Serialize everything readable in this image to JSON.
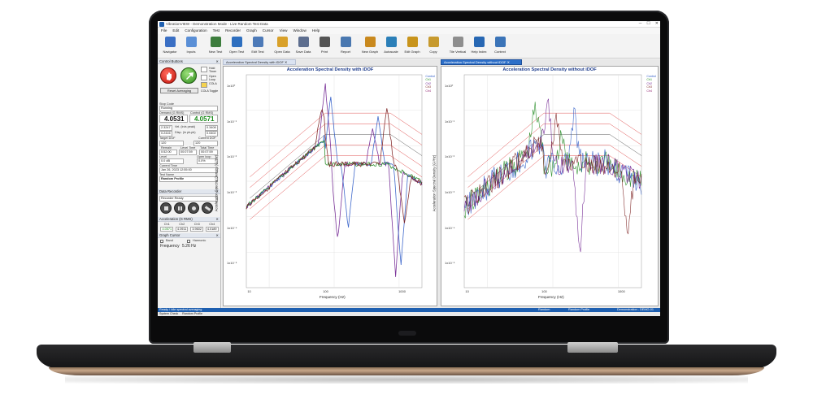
{
  "window": {
    "title": "VibrationVIEW - Demonstration Mode - Live Random Test Data",
    "controls": [
      "─",
      "☐",
      "✕"
    ]
  },
  "menu": [
    "File",
    "Edit",
    "Configuration",
    "Test",
    "Recorder",
    "Graph",
    "Cursor",
    "View",
    "Window",
    "Help"
  ],
  "toolbar": [
    {
      "label": "Navigator",
      "color": "#3a6fc4"
    },
    {
      "label": "Inputs",
      "color": "#5a8fd6"
    },
    {
      "label": "New Test",
      "color": "#3d7d3d"
    },
    {
      "label": "Open Test",
      "color": "#2e6fbf"
    },
    {
      "label": "Edit Test",
      "color": "#4d7ab8"
    },
    {
      "label": "Open Data",
      "color": "#d9a12a"
    },
    {
      "label": "Save Data",
      "color": "#5d6e8f"
    },
    {
      "label": "Print",
      "color": "#555555"
    },
    {
      "label": "Report",
      "color": "#4a78b0"
    },
    {
      "label": "New Graph",
      "color": "#c9891e"
    },
    {
      "label": "Autoscale",
      "color": "#2b7fb8"
    },
    {
      "label": "Edit Graph",
      "color": "#c8941c"
    },
    {
      "label": "Copy",
      "color": "#c79a2e"
    },
    {
      "label": "Tile Vertical",
      "color": "#8e8e8e"
    },
    {
      "label": "Help Index",
      "color": "#2767b3"
    },
    {
      "label": "Context",
      "color": "#3b74b8"
    }
  ],
  "control_panel": {
    "header": "Control Buttons",
    "side_buttons": [
      "Hold Timer",
      "Open Loop",
      "COLA",
      "COLA Toggle"
    ],
    "reset_label": "Reset Averaging",
    "stop_code_label": "Stop Code",
    "stop_code_value": "Running",
    "demand_label": "Demand (G RMS)",
    "demand_value": "4.0531",
    "control_label": "Control (G RMS)",
    "control_value": "4.0571",
    "disp_value": "2.3247",
    "disp_label": "Vel. (in/s peak)",
    "disp_right": "0.3408",
    "pk_value": "0.2416",
    "pk_label": "Disp. (in pk-pk)",
    "pk_right": "0.0402",
    "dof_left_label": "Target DOF",
    "dof_right_label": "Current DOF",
    "dof_left_value": "120",
    "dof_right_value": "120",
    "remain_label": "Remain",
    "level_label": "Level Time",
    "total_label": "Total Time",
    "remain_value": "0:52:00",
    "level_value": "00:07:59",
    "total_value": "00:07:59",
    "level_pct_label": "Level",
    "level_pct_value": "0.0 dB",
    "open_loop_label": "Open loop",
    "open_loop_value": "0.0%",
    "current_time_label": "Current Time",
    "current_time_value": "Jan 26, 2023 12:55:00",
    "test_name_label": "Test Name",
    "test_name_value": "Random Profile"
  },
  "data_recorder": {
    "header": "Data Recorder",
    "status": "Recorder Ready"
  },
  "acceleration": {
    "header": "Acceleration (G RMS)",
    "columns": [
      "Ch1",
      "Ch2",
      "Ch3",
      "Ch4"
    ],
    "values": [
      "4.0571",
      "4.0911",
      "3.9602",
      "4.0189"
    ]
  },
  "graph_cursor": {
    "header": "Graph Cursor",
    "mode_left": "Band",
    "mode_right": "Harmonic",
    "frequency_label": "Frequency",
    "frequency_value": "5.26 Hz"
  },
  "charts": [
    {
      "tab": "Acceleration Spectral Density with iDOF",
      "title": "Acceleration Spectral Density with iDOF",
      "xlabel": "Frequency (Hz)",
      "ylabel": "Acceleration Spectral Density (G²/Hz)",
      "xticks": [
        "10",
        "100",
        "1000"
      ],
      "yticks": [
        "1x10⁰",
        "1x10⁻¹",
        "1x10⁻²",
        "1x10⁻³",
        "1x10⁻⁴",
        "1x10⁻⁵"
      ],
      "legend": [
        "Control",
        "Ch1",
        "Ch2",
        "Ch3",
        "Ch4"
      ]
    },
    {
      "tab": "Acceleration Spectral Density without iDOF",
      "title": "Acceleration Spectral Density without iDOF",
      "xlabel": "Frequency (Hz)",
      "ylabel": "Acceleration Spectral Density (G²/Hz)",
      "xticks": [
        "10",
        "100",
        "1000"
      ],
      "yticks": [
        "1x10⁰",
        "1x10⁻¹",
        "1x10⁻²",
        "1x10⁻³",
        "1x10⁻⁴",
        "1x10⁻⁵"
      ],
      "legend": [
        "Control",
        "Ch1",
        "Ch2",
        "Ch3",
        "Ch4"
      ]
    }
  ],
  "legend_colors": [
    "#2c5ac7",
    "#1f8a1f",
    "#6e1f8f",
    "#7a1d1d",
    "#8f1f6e"
  ],
  "status": {
    "left": "Ready / Idle spectral averaging",
    "mode": "Random",
    "profile": "Random Profile",
    "right": "Demonstration - DEMO-01"
  },
  "bottom_tabs": [
    "System Check",
    "Random Profile"
  ]
}
